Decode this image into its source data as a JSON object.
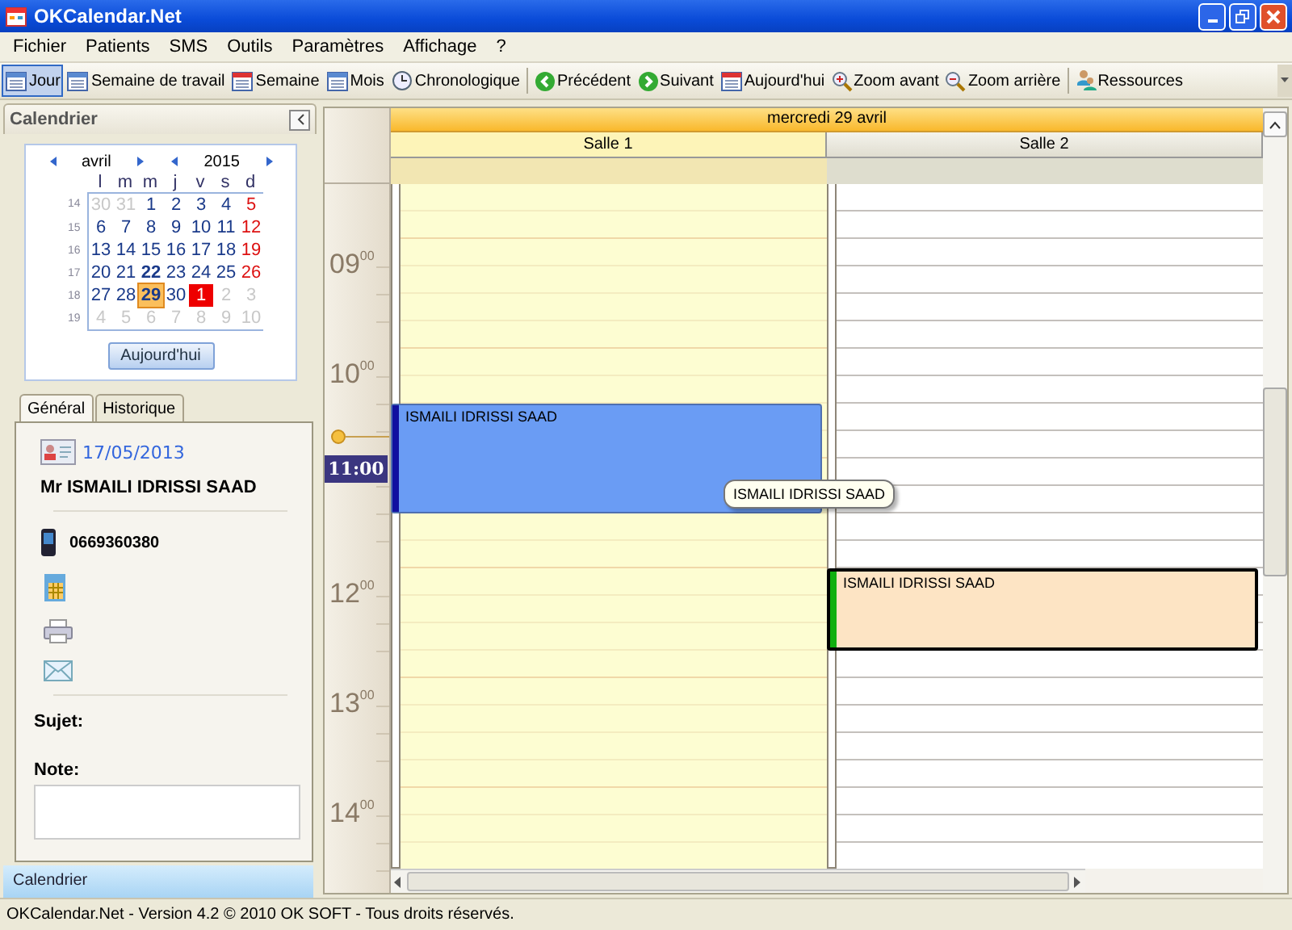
{
  "window": {
    "title": "OKCalendar.Net"
  },
  "menu": [
    "Fichier",
    "Patients",
    "SMS",
    "Outils",
    "Paramètres",
    "Affichage",
    "?"
  ],
  "toolbar": [
    {
      "kind": "day",
      "label": "Jour",
      "selected": true
    },
    {
      "kind": "week",
      "label": "Semaine de travail",
      "selected": false
    },
    {
      "kind": "week1",
      "label": "Semaine",
      "selected": false
    },
    {
      "kind": "month",
      "label": "Mois",
      "selected": false
    },
    {
      "kind": "timeline",
      "label": "Chronologique",
      "selected": false
    },
    {
      "kind": "separator"
    },
    {
      "kind": "prev",
      "label": "Précédent",
      "selected": false
    },
    {
      "kind": "next",
      "label": "Suivant",
      "selected": false
    },
    {
      "kind": "today",
      "label": "Aujourd'hui",
      "selected": false
    },
    {
      "kind": "zoomin",
      "label": "Zoom avant",
      "selected": false
    },
    {
      "kind": "zoomout",
      "label": "Zoom arrière",
      "selected": false
    },
    {
      "kind": "separator"
    },
    {
      "kind": "resources",
      "label": "Ressources",
      "selected": false
    }
  ],
  "calendar_panel": {
    "title": "Calendrier",
    "month": "avril",
    "year": "2015",
    "weekdays": [
      "l",
      "m",
      "m",
      "j",
      "v",
      "s",
      "d"
    ],
    "weeks": [
      {
        "number": "14",
        "days": [
          {
            "day": "30",
            "kind": "other"
          },
          {
            "day": "31",
            "kind": "other"
          },
          {
            "day": "1",
            "kind": "day"
          },
          {
            "day": "2",
            "kind": "day"
          },
          {
            "day": "3",
            "kind": "day"
          },
          {
            "day": "4",
            "kind": "day"
          },
          {
            "day": "5",
            "kind": "sunday"
          }
        ]
      },
      {
        "number": "15",
        "days": [
          {
            "day": "6",
            "kind": "day"
          },
          {
            "day": "7",
            "kind": "day"
          },
          {
            "day": "8",
            "kind": "day"
          },
          {
            "day": "9",
            "kind": "day"
          },
          {
            "day": "10",
            "kind": "day"
          },
          {
            "day": "11",
            "kind": "day"
          },
          {
            "day": "12",
            "kind": "sunday"
          }
        ]
      },
      {
        "number": "16",
        "days": [
          {
            "day": "13",
            "kind": "day"
          },
          {
            "day": "14",
            "kind": "day"
          },
          {
            "day": "15",
            "kind": "day"
          },
          {
            "day": "16",
            "kind": "day"
          },
          {
            "day": "17",
            "kind": "day"
          },
          {
            "day": "18",
            "kind": "day"
          },
          {
            "day": "19",
            "kind": "sunday"
          }
        ]
      },
      {
        "number": "17",
        "days": [
          {
            "day": "20",
            "kind": "day"
          },
          {
            "day": "21",
            "kind": "day"
          },
          {
            "day": "22",
            "kind": "bold"
          },
          {
            "day": "23",
            "kind": "day"
          },
          {
            "day": "24",
            "kind": "day"
          },
          {
            "day": "25",
            "kind": "day"
          },
          {
            "day": "26",
            "kind": "sunday"
          }
        ]
      },
      {
        "number": "18",
        "days": [
          {
            "day": "27",
            "kind": "day"
          },
          {
            "day": "28",
            "kind": "day"
          },
          {
            "day": "29",
            "kind": "selected"
          },
          {
            "day": "30",
            "kind": "day"
          },
          {
            "day": "1",
            "kind": "today"
          },
          {
            "day": "2",
            "kind": "other"
          },
          {
            "day": "3",
            "kind": "other"
          }
        ]
      },
      {
        "number": "19",
        "days": [
          {
            "day": "4",
            "kind": "other"
          },
          {
            "day": "5",
            "kind": "other"
          },
          {
            "day": "6",
            "kind": "other"
          },
          {
            "day": "7",
            "kind": "other"
          },
          {
            "day": "8",
            "kind": "other"
          },
          {
            "day": "9",
            "kind": "other"
          },
          {
            "day": "10",
            "kind": "other"
          }
        ]
      }
    ],
    "today_button": "Aujourd'hui"
  },
  "tabs": [
    {
      "label": "Général",
      "selected": true
    },
    {
      "label": "Historique",
      "selected": false
    }
  ],
  "details": {
    "date": "17/05/2013",
    "name": "Mr ISMAILI IDRISSI SAAD",
    "mobile": "0669360380",
    "subject_label": "Sujet:",
    "note_label": "Note:"
  },
  "nav_bar": "Calendrier",
  "scheduler": {
    "date": "mercredi 29 avril",
    "resources": [
      {
        "name": "Salle 1",
        "selected": true
      },
      {
        "name": "Salle 2",
        "selected": false
      }
    ],
    "hours": [
      {
        "kind": "label",
        "hour": "09",
        "minutes": "00"
      },
      {
        "kind": "label",
        "hour": "10",
        "minutes": "00"
      },
      {
        "kind": "covered"
      },
      {
        "kind": "label",
        "hour": "12",
        "minutes": "00"
      },
      {
        "kind": "label",
        "hour": "13",
        "minutes": "00"
      },
      {
        "kind": "label",
        "hour": "14",
        "minutes": "00"
      }
    ],
    "current_time": "11:00",
    "appointments": [
      {
        "text": "ISMAILI IDRISSI SAAD",
        "color": "#6a9cf4",
        "selected": false
      },
      {
        "text": "ISMAILI IDRISSI SAAD",
        "color": "#fde4c4",
        "selected": true
      }
    ],
    "tooltip": "ISMAILI IDRISSI SAAD"
  },
  "status_bar": "OKCalendar.Net - Version 4.2 © 2010 OK SOFT - Tous droits réservés."
}
